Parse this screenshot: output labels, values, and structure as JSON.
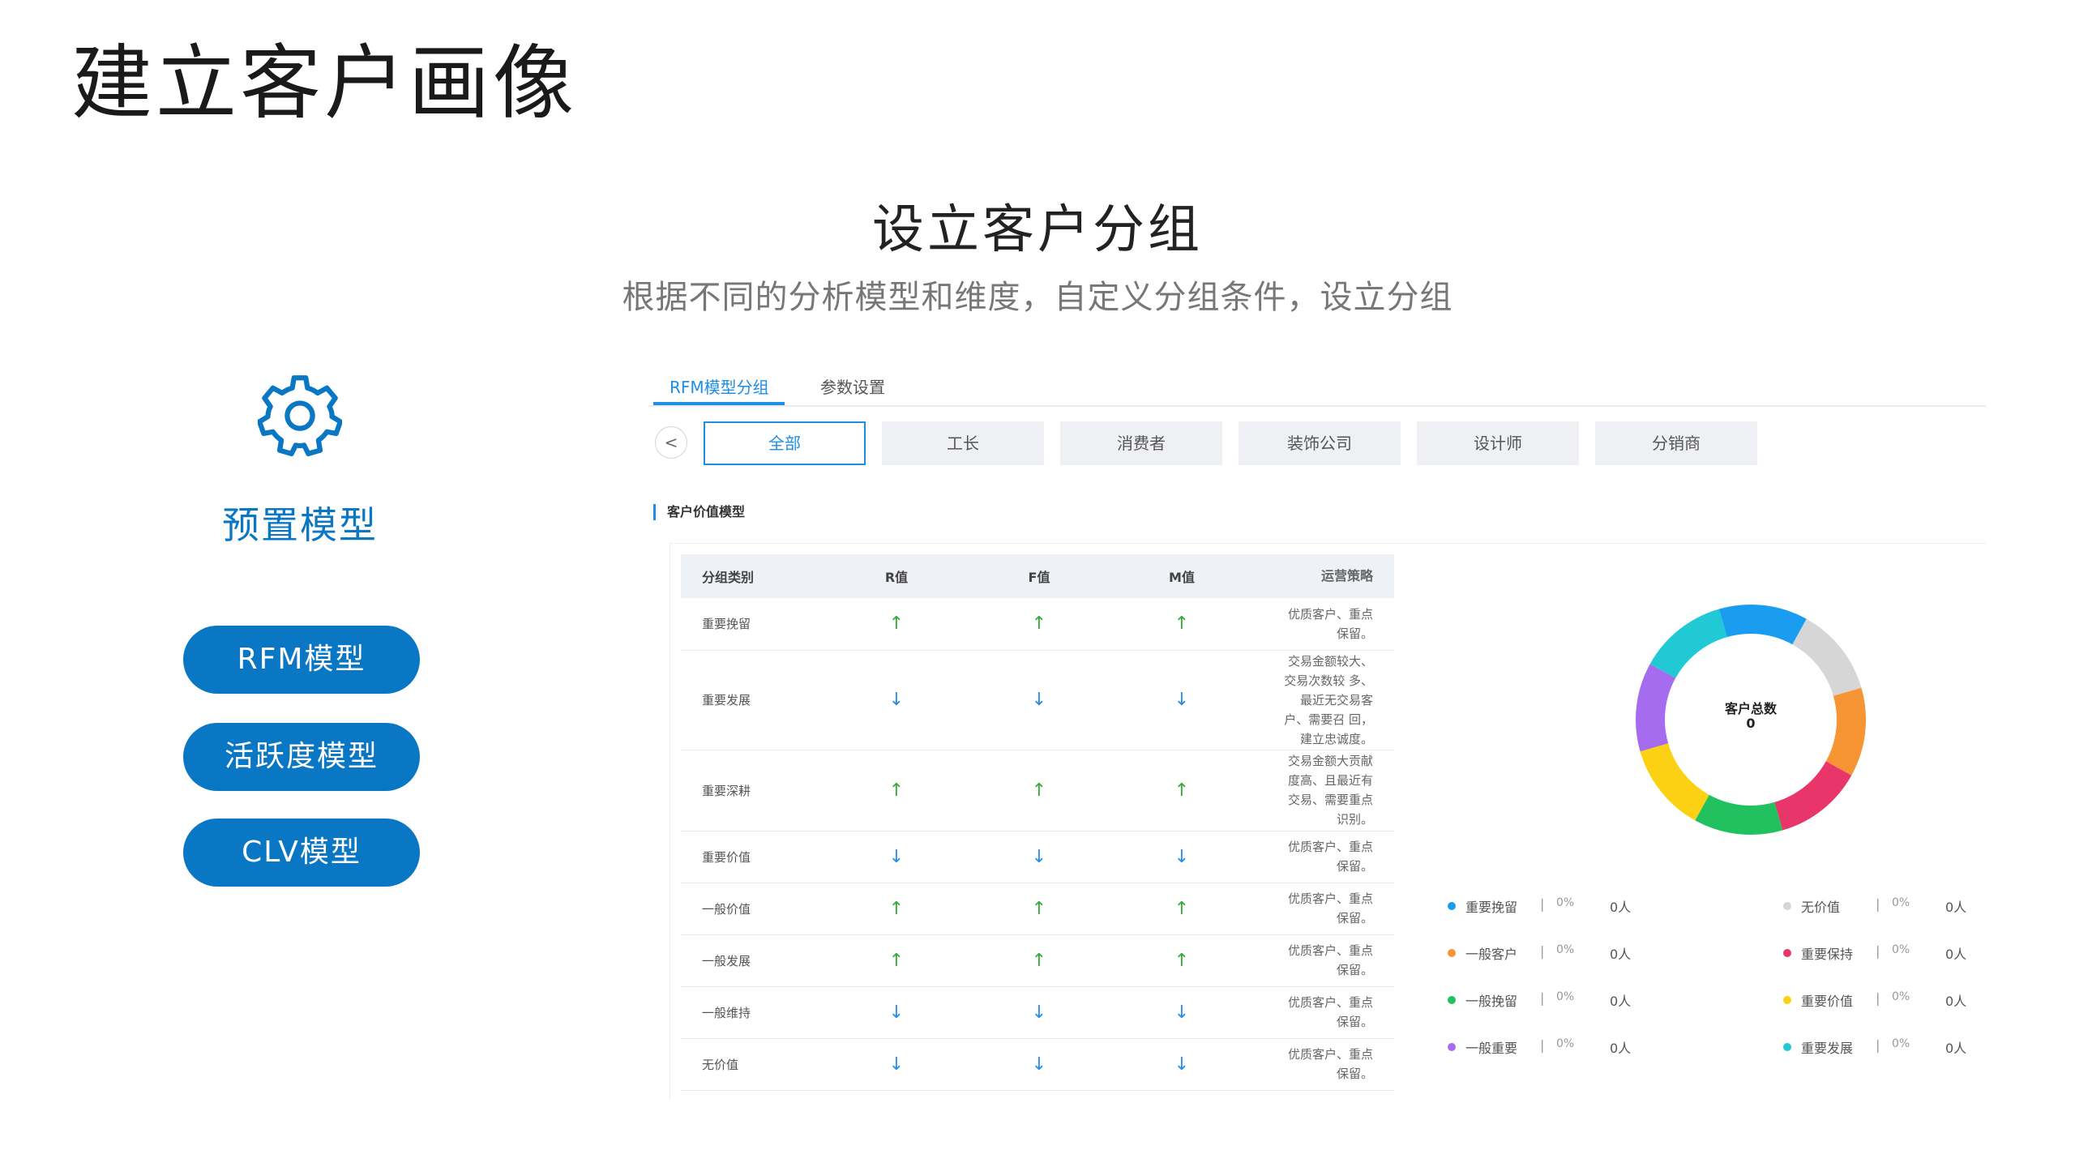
{
  "page_title": "建立客户画像",
  "section": {
    "title": "设立客户分组",
    "subtitle": "根据不同的分析模型和维度，自定义分组条件，设立分组"
  },
  "left_panel": {
    "label": "预置模型",
    "models": [
      "RFM模型",
      "活跃度模型",
      "CLV模型"
    ]
  },
  "tabs": [
    "RFM模型分组",
    "参数设置"
  ],
  "prev_label": "<",
  "categories": [
    "全部",
    "工长",
    "消费者",
    "装饰公司",
    "设计师",
    "分销商"
  ],
  "block_title": "客户价值模型",
  "table": {
    "headers": [
      "分组类别",
      "R值",
      "F值",
      "M值",
      "运营策略"
    ],
    "rows": [
      {
        "name": "重要挽留",
        "r": "↑",
        "f": "↑",
        "m": "↑",
        "dir": "up",
        "strategy": [
          "优质客户、重点",
          "保留。"
        ]
      },
      {
        "name": "重要发展",
        "r": "↓",
        "f": "↓",
        "m": "↓",
        "dir": "down",
        "strategy": [
          "交易金额较大、",
          "交易次数较 多、",
          "最近无交易客",
          "户、需要召 回，",
          "建立忠诚度。"
        ]
      },
      {
        "name": "重要深耕",
        "r": "↑",
        "f": "↑",
        "m": "↑",
        "dir": "up",
        "strategy": [
          "交易金额大贡献",
          "度高、且最近有",
          "交易、需要重点",
          "识别。"
        ]
      },
      {
        "name": "重要价值",
        "r": "↓",
        "f": "↓",
        "m": "↓",
        "dir": "down",
        "strategy": [
          "优质客户、重点",
          "保留。"
        ]
      },
      {
        "name": "一般价值",
        "r": "↑",
        "f": "↑",
        "m": "↑",
        "dir": "up",
        "strategy": [
          "优质客户、重点",
          "保留。"
        ]
      },
      {
        "name": "一般发展",
        "r": "↑",
        "f": "↑",
        "m": "↑",
        "dir": "up",
        "strategy": [
          "优质客户、重点",
          "保留。"
        ]
      },
      {
        "name": "一般维持",
        "r": "↓",
        "f": "↓",
        "m": "↓",
        "dir": "down",
        "strategy": [
          "优质客户、重点",
          "保留。"
        ]
      },
      {
        "name": "无价值",
        "r": "↓",
        "f": "↓",
        "m": "↓",
        "dir": "down",
        "strategy": [
          "优质客户、重点",
          "保留。"
        ]
      }
    ]
  },
  "donut": {
    "center_label": "客户总数",
    "center_value": "0",
    "segments": [
      {
        "name": "重要挽留",
        "color": "#1a9cf0"
      },
      {
        "name": "无价值",
        "color": "#d6d6d6"
      },
      {
        "name": "一般客户",
        "color": "#f79433"
      },
      {
        "name": "重要保持",
        "color": "#e8356a"
      },
      {
        "name": "一般挽留",
        "color": "#20c15e"
      },
      {
        "name": "重要价值",
        "color": "#fdd113"
      },
      {
        "name": "一般重要",
        "color": "#a66cf0"
      },
      {
        "name": "重要发展",
        "color": "#20c9d4"
      }
    ]
  },
  "legend": {
    "left": [
      {
        "name": "重要挽留",
        "pct": "0%",
        "count": "0人",
        "color": "#1a9cf0"
      },
      {
        "name": "一般客户",
        "pct": "0%",
        "count": "0人",
        "color": "#f79433"
      },
      {
        "name": "一般挽留",
        "pct": "0%",
        "count": "0人",
        "color": "#20c15e"
      },
      {
        "name": "一般重要",
        "pct": "0%",
        "count": "0人",
        "color": "#a66cf0"
      }
    ],
    "right": [
      {
        "name": "无价值",
        "pct": "0%",
        "count": "0人",
        "color": "#d6d6d6"
      },
      {
        "name": "重要保持",
        "pct": "0%",
        "count": "0人",
        "color": "#e8356a"
      },
      {
        "name": "重要价值",
        "pct": "0%",
        "count": "0人",
        "color": "#fdd113"
      },
      {
        "name": "重要发展",
        "pct": "0%",
        "count": "0人",
        "color": "#20c9d4"
      }
    ]
  }
}
